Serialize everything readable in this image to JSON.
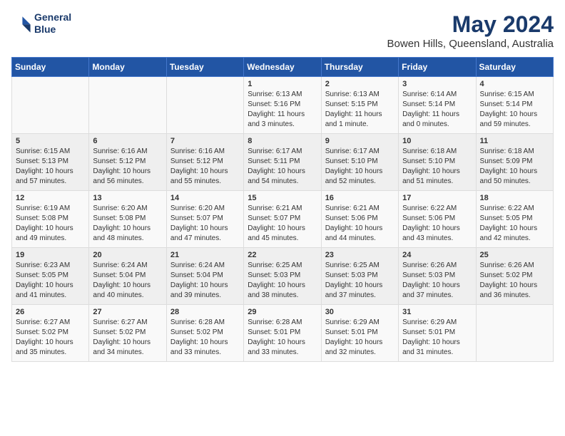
{
  "logo": {
    "line1": "General",
    "line2": "Blue"
  },
  "title": "May 2024",
  "subtitle": "Bowen Hills, Queensland, Australia",
  "weekdays": [
    "Sunday",
    "Monday",
    "Tuesday",
    "Wednesday",
    "Thursday",
    "Friday",
    "Saturday"
  ],
  "weeks": [
    [
      {
        "day": "",
        "info": ""
      },
      {
        "day": "",
        "info": ""
      },
      {
        "day": "",
        "info": ""
      },
      {
        "day": "1",
        "info": "Sunrise: 6:13 AM\nSunset: 5:16 PM\nDaylight: 11 hours and 3 minutes."
      },
      {
        "day": "2",
        "info": "Sunrise: 6:13 AM\nSunset: 5:15 PM\nDaylight: 11 hours and 1 minute."
      },
      {
        "day": "3",
        "info": "Sunrise: 6:14 AM\nSunset: 5:14 PM\nDaylight: 11 hours and 0 minutes."
      },
      {
        "day": "4",
        "info": "Sunrise: 6:15 AM\nSunset: 5:14 PM\nDaylight: 10 hours and 59 minutes."
      }
    ],
    [
      {
        "day": "5",
        "info": "Sunrise: 6:15 AM\nSunset: 5:13 PM\nDaylight: 10 hours and 57 minutes."
      },
      {
        "day": "6",
        "info": "Sunrise: 6:16 AM\nSunset: 5:12 PM\nDaylight: 10 hours and 56 minutes."
      },
      {
        "day": "7",
        "info": "Sunrise: 6:16 AM\nSunset: 5:12 PM\nDaylight: 10 hours and 55 minutes."
      },
      {
        "day": "8",
        "info": "Sunrise: 6:17 AM\nSunset: 5:11 PM\nDaylight: 10 hours and 54 minutes."
      },
      {
        "day": "9",
        "info": "Sunrise: 6:17 AM\nSunset: 5:10 PM\nDaylight: 10 hours and 52 minutes."
      },
      {
        "day": "10",
        "info": "Sunrise: 6:18 AM\nSunset: 5:10 PM\nDaylight: 10 hours and 51 minutes."
      },
      {
        "day": "11",
        "info": "Sunrise: 6:18 AM\nSunset: 5:09 PM\nDaylight: 10 hours and 50 minutes."
      }
    ],
    [
      {
        "day": "12",
        "info": "Sunrise: 6:19 AM\nSunset: 5:08 PM\nDaylight: 10 hours and 49 minutes."
      },
      {
        "day": "13",
        "info": "Sunrise: 6:20 AM\nSunset: 5:08 PM\nDaylight: 10 hours and 48 minutes."
      },
      {
        "day": "14",
        "info": "Sunrise: 6:20 AM\nSunset: 5:07 PM\nDaylight: 10 hours and 47 minutes."
      },
      {
        "day": "15",
        "info": "Sunrise: 6:21 AM\nSunset: 5:07 PM\nDaylight: 10 hours and 45 minutes."
      },
      {
        "day": "16",
        "info": "Sunrise: 6:21 AM\nSunset: 5:06 PM\nDaylight: 10 hours and 44 minutes."
      },
      {
        "day": "17",
        "info": "Sunrise: 6:22 AM\nSunset: 5:06 PM\nDaylight: 10 hours and 43 minutes."
      },
      {
        "day": "18",
        "info": "Sunrise: 6:22 AM\nSunset: 5:05 PM\nDaylight: 10 hours and 42 minutes."
      }
    ],
    [
      {
        "day": "19",
        "info": "Sunrise: 6:23 AM\nSunset: 5:05 PM\nDaylight: 10 hours and 41 minutes."
      },
      {
        "day": "20",
        "info": "Sunrise: 6:24 AM\nSunset: 5:04 PM\nDaylight: 10 hours and 40 minutes."
      },
      {
        "day": "21",
        "info": "Sunrise: 6:24 AM\nSunset: 5:04 PM\nDaylight: 10 hours and 39 minutes."
      },
      {
        "day": "22",
        "info": "Sunrise: 6:25 AM\nSunset: 5:03 PM\nDaylight: 10 hours and 38 minutes."
      },
      {
        "day": "23",
        "info": "Sunrise: 6:25 AM\nSunset: 5:03 PM\nDaylight: 10 hours and 37 minutes."
      },
      {
        "day": "24",
        "info": "Sunrise: 6:26 AM\nSunset: 5:03 PM\nDaylight: 10 hours and 37 minutes."
      },
      {
        "day": "25",
        "info": "Sunrise: 6:26 AM\nSunset: 5:02 PM\nDaylight: 10 hours and 36 minutes."
      }
    ],
    [
      {
        "day": "26",
        "info": "Sunrise: 6:27 AM\nSunset: 5:02 PM\nDaylight: 10 hours and 35 minutes."
      },
      {
        "day": "27",
        "info": "Sunrise: 6:27 AM\nSunset: 5:02 PM\nDaylight: 10 hours and 34 minutes."
      },
      {
        "day": "28",
        "info": "Sunrise: 6:28 AM\nSunset: 5:02 PM\nDaylight: 10 hours and 33 minutes."
      },
      {
        "day": "29",
        "info": "Sunrise: 6:28 AM\nSunset: 5:01 PM\nDaylight: 10 hours and 33 minutes."
      },
      {
        "day": "30",
        "info": "Sunrise: 6:29 AM\nSunset: 5:01 PM\nDaylight: 10 hours and 32 minutes."
      },
      {
        "day": "31",
        "info": "Sunrise: 6:29 AM\nSunset: 5:01 PM\nDaylight: 10 hours and 31 minutes."
      },
      {
        "day": "",
        "info": ""
      }
    ]
  ]
}
